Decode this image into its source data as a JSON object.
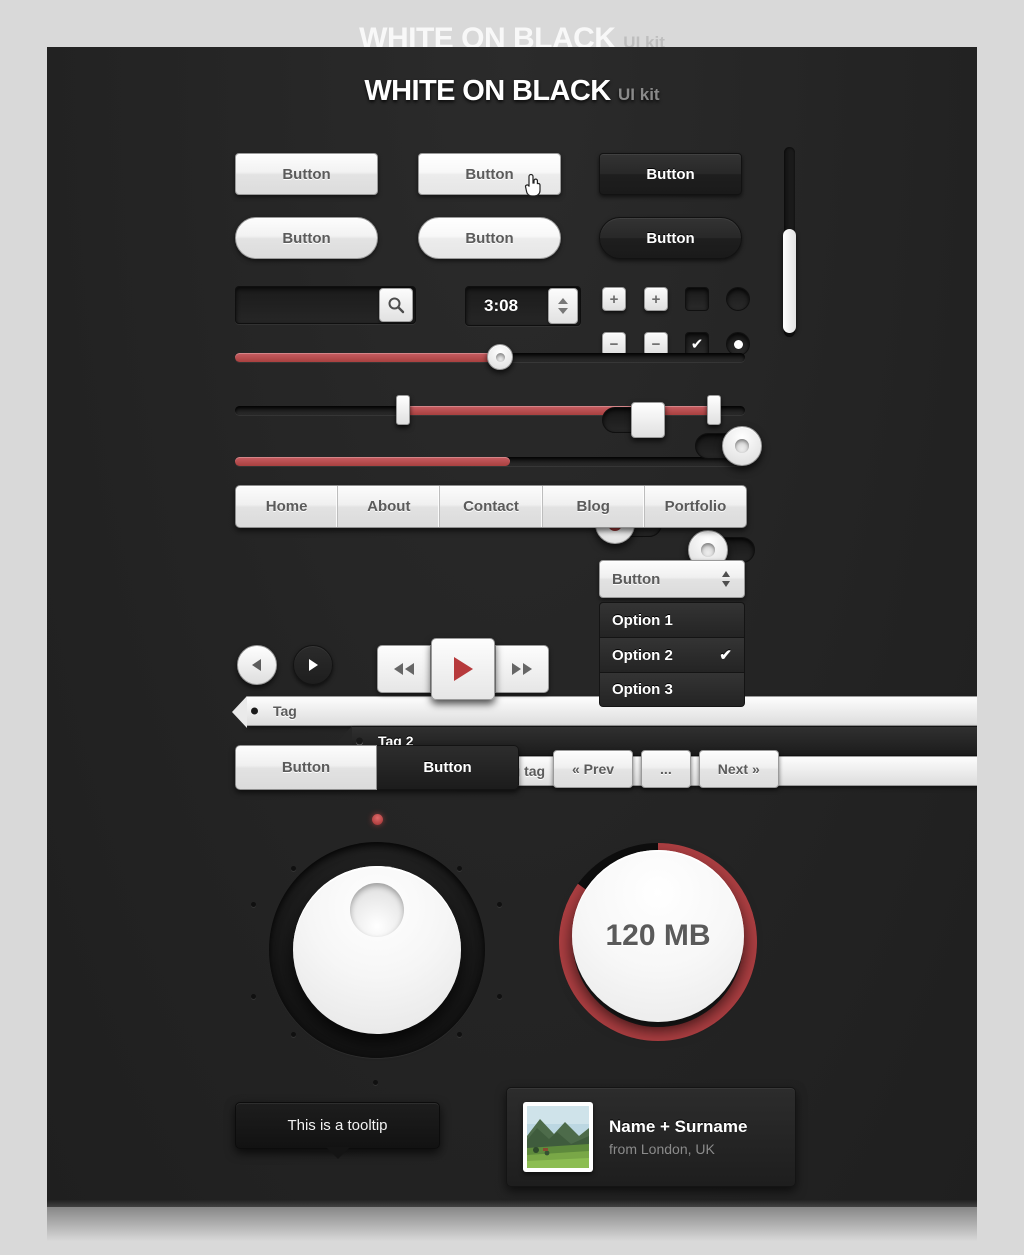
{
  "page": {
    "title_main": "WHITE ON BLACK",
    "title_sub": "UI kit",
    "accent_red": "#b84a4c",
    "panel_bg": "#242424",
    "page_bg": "#d9d9d9"
  },
  "buttons": {
    "normal_label": "Button",
    "hover_label": "Button",
    "dark_label": "Button",
    "pill_normal_label": "Button",
    "pill_hover_label": "Button",
    "pill_dark_label": "Button"
  },
  "search": {
    "value": "",
    "placeholder": "",
    "icon": "search-icon"
  },
  "stepper": {
    "value": "3:08",
    "up_icon": "triangle-up-icon",
    "down_icon": "triangle-down-icon"
  },
  "small_controls": {
    "plus_label": "+",
    "plus_alt_label": "+",
    "minus_label": "−",
    "minus_alt_label": "−",
    "check_mark": "✔",
    "checkbox_unchecked": "",
    "radio_unselected": "",
    "radio_selected_dot": ""
  },
  "sliders": {
    "single": {
      "value": 52,
      "min": 0,
      "max": 100
    },
    "range": {
      "start": 33,
      "end": 94
    },
    "progress": {
      "value": 54,
      "min": 0,
      "max": 100
    }
  },
  "toggles": [
    {
      "name": "toggle-square",
      "state": "on"
    },
    {
      "name": "toggle-round",
      "state": "on"
    },
    {
      "name": "toggle-record",
      "state": "off"
    },
    {
      "name": "toggle-plain",
      "state": "off"
    }
  ],
  "nav": {
    "items": [
      {
        "label": "Home"
      },
      {
        "label": "About"
      },
      {
        "label": "Contact"
      },
      {
        "label": "Blog"
      },
      {
        "label": "Portfolio"
      }
    ]
  },
  "tags": [
    {
      "label": "Tag",
      "style": "light"
    },
    {
      "label": "Tag 2",
      "style": "dark"
    },
    {
      "label": "Long tag",
      "style": "light"
    }
  ],
  "dropdown": {
    "selected_label": "Button",
    "chevron_icon": "chevron-updown-icon",
    "options": [
      {
        "label": "Option 1",
        "checked": false
      },
      {
        "label": "Option 2",
        "checked": true
      },
      {
        "label": "Option 3",
        "checked": false
      }
    ],
    "check_mark": "✔"
  },
  "pager_circles": {
    "prev_icon": "triangle-left-icon",
    "next_icon": "triangle-right-icon"
  },
  "media": {
    "rewind_icon": "rewind-icon",
    "play_icon": "play-icon",
    "forward_icon": "fast-forward-icon"
  },
  "segmented": {
    "active_label": "Button",
    "inactive_label": "Button"
  },
  "pagination": {
    "prev_label": "« Prev",
    "ellipsis_label": "...",
    "next_label": "Next »"
  },
  "dial": {
    "name": "rotary-knob",
    "led": "red-led-indicator"
  },
  "gauge": {
    "value_label": "120 MB",
    "percent": 85
  },
  "tooltip": {
    "text": "This is a tooltip"
  },
  "user_card": {
    "name": "Name + Surname",
    "location": "from London, UK",
    "avatar": "landscape-photo-avatar"
  },
  "scrollbar": {
    "thumb_position": "lower"
  }
}
